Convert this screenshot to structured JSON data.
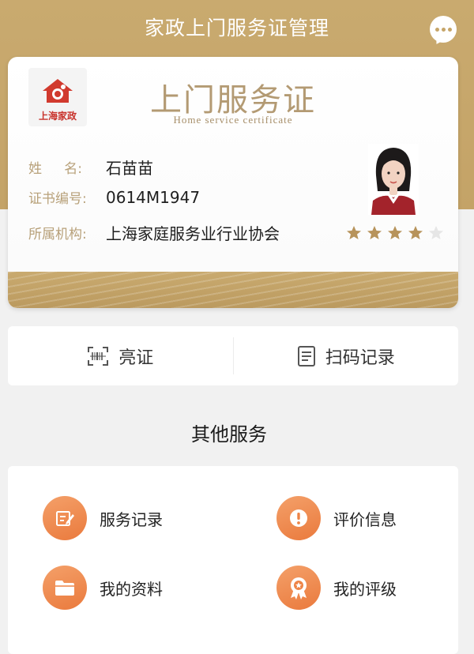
{
  "header": {
    "title": "家政上门服务证管理",
    "accent_color": "#c6a569"
  },
  "certificate": {
    "logo_text": "上海家政",
    "title": "上门服务证",
    "subtitle": "Home service certificate",
    "fields": [
      {
        "label_a": "姓",
        "label_b": "名:",
        "value": "石苗苗"
      },
      {
        "label": "证书编号:",
        "value": "0614M1947"
      },
      {
        "label": "所属机构:",
        "value": "上海家庭服务业行业协会"
      }
    ],
    "rating": 4,
    "rating_max": 5
  },
  "actions": [
    {
      "label": "亮证",
      "icon": "scan-icon"
    },
    {
      "label": "扫码记录",
      "icon": "document-icon"
    }
  ],
  "other_services": {
    "title": "其他服务",
    "items": [
      {
        "label": "服务记录",
        "icon": "edit-icon"
      },
      {
        "label": "评价信息",
        "icon": "exclamation-icon"
      },
      {
        "label": "我的资料",
        "icon": "folder-icon"
      },
      {
        "label": "我的评级",
        "icon": "badge-icon"
      }
    ],
    "icon_color": "#ee8447"
  }
}
